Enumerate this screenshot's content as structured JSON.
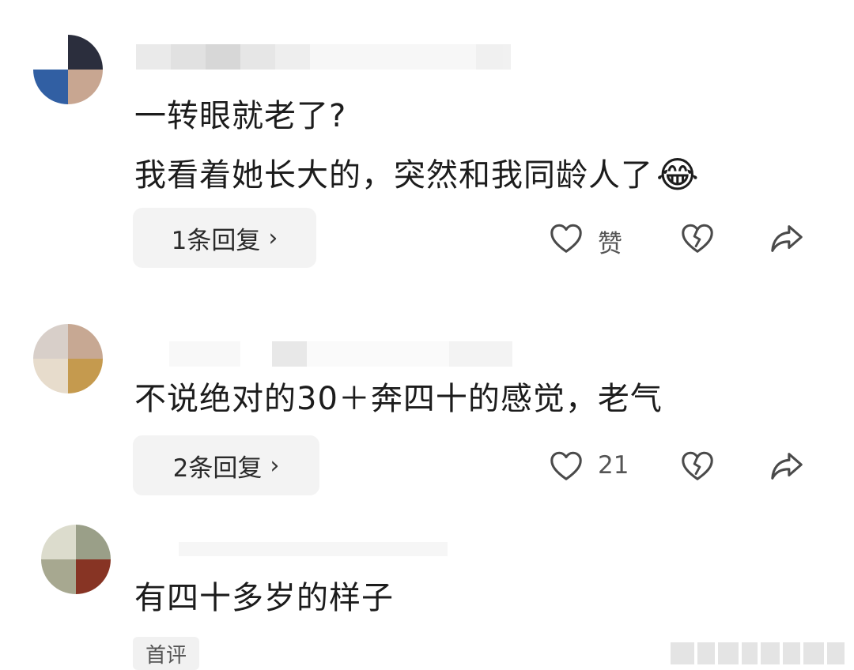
{
  "comments": [
    {
      "content_lines": [
        "一转眼就老了?",
        "我看着她长大的，突然和我同龄人了"
      ],
      "emoji": "😂",
      "reply_label": "1条回复",
      "like_text": "赞",
      "avatar_colors": [
        "#ffffff",
        "#2b2e3e",
        "#2f5fa7",
        "#c9a690"
      ]
    },
    {
      "content_lines": [
        "不说绝对的30＋奔四十的感觉，老气"
      ],
      "reply_label": "2条回复",
      "like_text": "21",
      "avatar_colors": [
        "#d8cfc9",
        "#c8a892",
        "#e7dccb",
        "#c79a4a"
      ]
    },
    {
      "content_lines": [
        "有四十多岁的样子"
      ],
      "tag_label": "首评",
      "avatar_colors": [
        "#dcdccc",
        "#9a9f87",
        "#a7a88f",
        "#8a3322"
      ]
    }
  ],
  "icons": {
    "heart": "heart-icon",
    "dislike": "broken-heart-icon",
    "share": "share-icon",
    "chevron": "chevron-right-icon"
  },
  "chevron_glyph": "›",
  "colors": {
    "button_bg": "#f3f3f3",
    "icon_stroke": "#4a4a4a"
  }
}
